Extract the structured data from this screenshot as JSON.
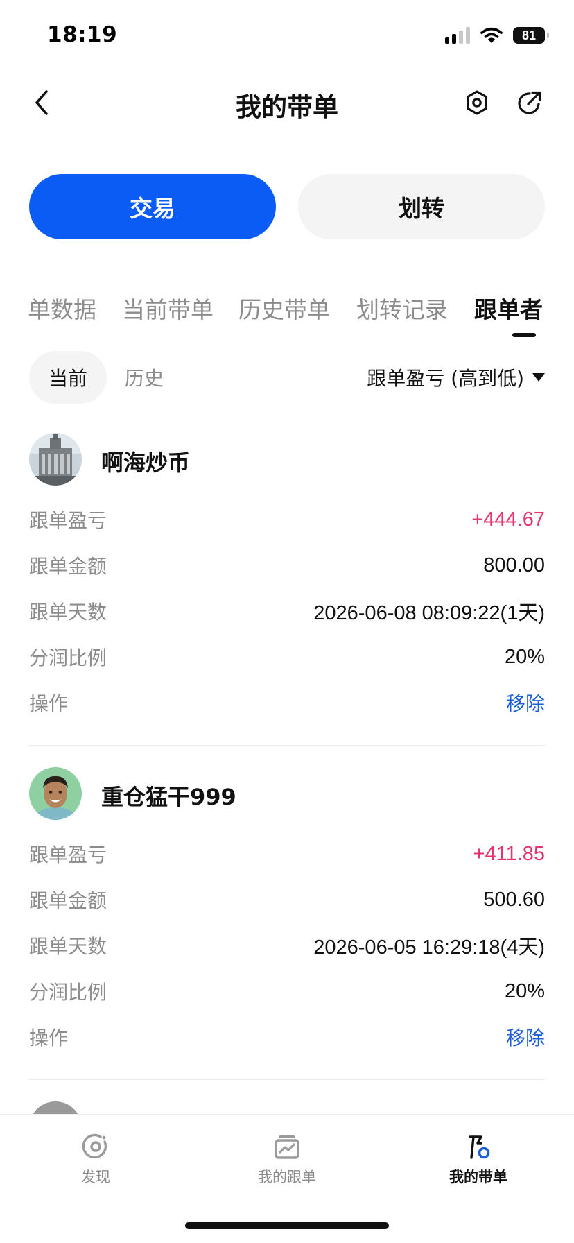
{
  "status_bar": {
    "time": "18:19",
    "battery": "81"
  },
  "header": {
    "title": "我的带单"
  },
  "actions": {
    "trade": "交易",
    "transfer": "划转"
  },
  "tabs": [
    {
      "label": "单数据",
      "active": false
    },
    {
      "label": "当前带单",
      "active": false
    },
    {
      "label": "历史带单",
      "active": false
    },
    {
      "label": "划转记录",
      "active": false
    },
    {
      "label": "跟单者",
      "active": true
    }
  ],
  "filters": {
    "current": "当前",
    "history": "历史",
    "sort": "跟单盈亏 (高到低)"
  },
  "followers": [
    {
      "name": "啊海炒币",
      "rows": [
        {
          "label": "跟单盈亏",
          "value": "+444.67"
        },
        {
          "label": "跟单金额",
          "value": "800.00"
        },
        {
          "label": "跟单天数",
          "value": "2026-06-08 08:09:22(1天)"
        },
        {
          "label": "分润比例",
          "value": "20%"
        },
        {
          "label": "操作",
          "value": "移除"
        }
      ]
    },
    {
      "name": "重仓猛干999",
      "rows": [
        {
          "label": "跟单盈亏",
          "value": "+411.85"
        },
        {
          "label": "跟单金额",
          "value": "500.60"
        },
        {
          "label": "跟单天数",
          "value": "2026-06-05 16:29:18(4天)"
        },
        {
          "label": "分润比例",
          "value": "20%"
        },
        {
          "label": "操作",
          "value": "移除"
        }
      ]
    }
  ],
  "colors": {
    "accent": "#0a5cf5",
    "profit": "#e8336b",
    "link": "#1a5fd8"
  },
  "bottom_nav": [
    {
      "label": "发现",
      "icon": "discover-icon",
      "active": false
    },
    {
      "label": "我的跟单",
      "icon": "chart-card-icon",
      "active": false
    },
    {
      "label": "我的带单",
      "icon": "flag-badge-icon",
      "active": true
    }
  ]
}
